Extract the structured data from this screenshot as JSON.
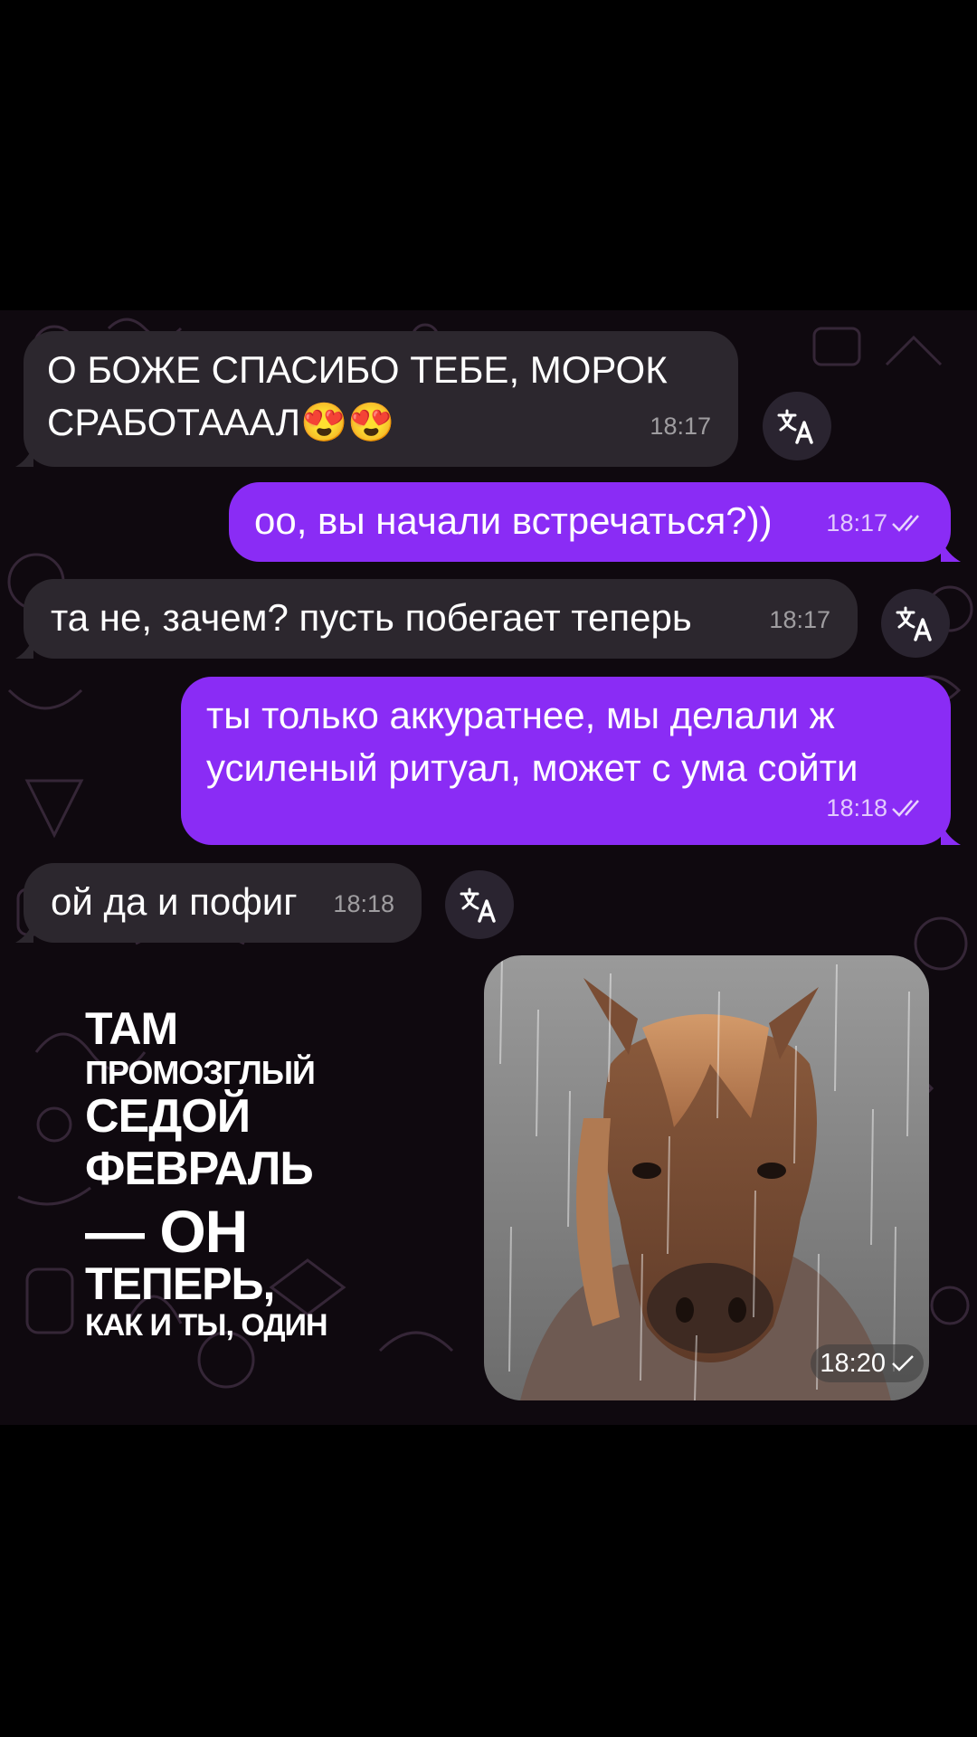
{
  "messages": [
    {
      "side": "in",
      "text_line1": "О БОЖЕ СПАСИБО ТЕБЕ, МОРОК",
      "text_line2": "СРАБОТАААЛ",
      "emoji": "😍😍",
      "time": "18:17"
    },
    {
      "side": "out",
      "text": "оо, вы начали встречаться?))",
      "time": "18:17",
      "status": "read"
    },
    {
      "side": "in",
      "text": "та не, зачем? пусть побегает теперь",
      "time": "18:17"
    },
    {
      "side": "out",
      "text_line1": "ты только аккуратнее, мы делали ж",
      "text_line2": "усиленый ритуал, может с ума сойти",
      "time": "18:18",
      "status": "read"
    },
    {
      "side": "in",
      "text": "ой да и пофиг",
      "time": "18:18"
    }
  ],
  "sticker": {
    "caption_lines": [
      "ТАМ",
      "ПРОМОЗГЛЫЙ",
      "СЕДОЙ",
      "ФЕВРАЛЬ",
      "— ОН",
      "ТЕПЕРЬ,",
      "КАК И ТЫ, ОДИН"
    ],
    "image": "horse-in-rain",
    "time": "18:20",
    "status": "sent"
  },
  "icons": {
    "translate": "translate-icon",
    "read": "double-check-icon",
    "sent": "check-icon"
  },
  "colors": {
    "outgoing": "#8a2cf5",
    "incoming": "#2c272e",
    "background": "#0f090f"
  }
}
